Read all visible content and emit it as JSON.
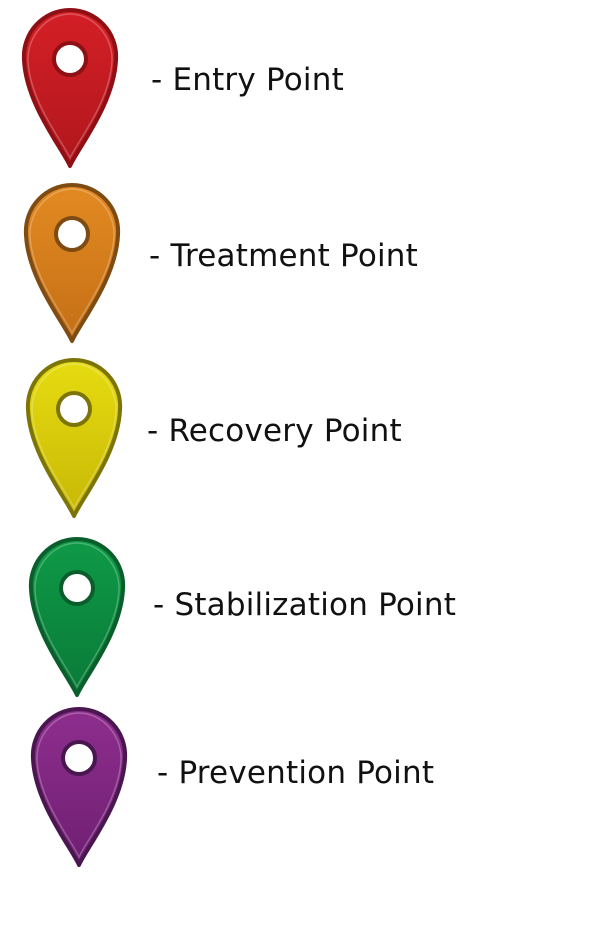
{
  "legend": {
    "items": [
      {
        "label": "- Entry Point",
        "icon": "map-pin-icon",
        "color": "#d41f26",
        "edge": "#8e0f14",
        "shade": "#b0171d"
      },
      {
        "label": "- Treatment Point",
        "icon": "map-pin-icon",
        "color": "#e38a22",
        "edge": "#7e4b12",
        "shade": "#c46f16"
      },
      {
        "label": "- Recovery Point",
        "icon": "map-pin-icon",
        "color": "#e6dc10",
        "edge": "#7d7407",
        "shade": "#c7b806"
      },
      {
        "label": "- Stabilization Point",
        "icon": "map-pin-icon",
        "color": "#0e9a47",
        "edge": "#0a5e2c",
        "shade": "#0a7a38"
      },
      {
        "label": "- Prevention Point",
        "icon": "map-pin-icon",
        "color": "#8e2e8e",
        "edge": "#4a1650",
        "shade": "#6f1f72"
      }
    ]
  }
}
